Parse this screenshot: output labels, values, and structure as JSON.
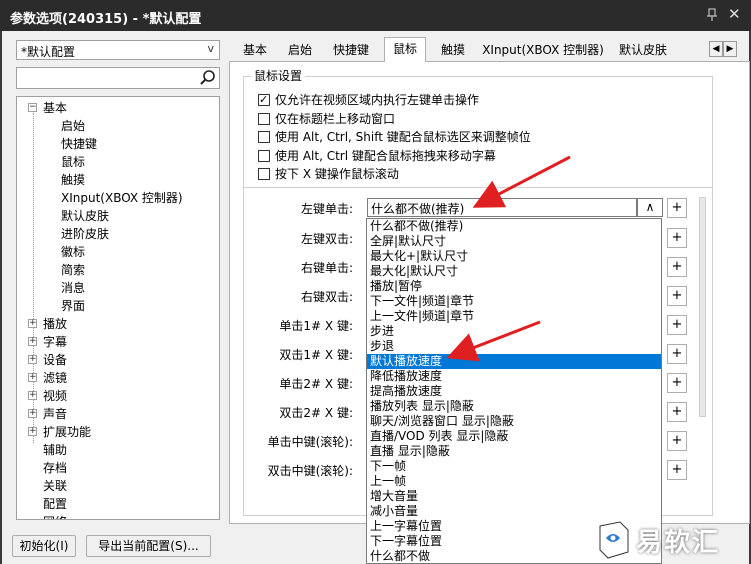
{
  "window": {
    "title": "参数选项(240315) - *默认配置",
    "pin_icon": "pin-icon",
    "close_icon": "close-icon"
  },
  "profile_select": {
    "value": "*默认配置"
  },
  "search": {
    "value": "",
    "icon": "search-icon"
  },
  "tree": {
    "items": [
      {
        "label": "基本",
        "level": 0,
        "expander": "minus"
      },
      {
        "label": "启始",
        "level": 1
      },
      {
        "label": "快捷键",
        "level": 1
      },
      {
        "label": "鼠标",
        "level": 1
      },
      {
        "label": "触摸",
        "level": 1
      },
      {
        "label": "XInput(XBOX 控制器)",
        "level": 1
      },
      {
        "label": "默认皮肤",
        "level": 1
      },
      {
        "label": "进阶皮肤",
        "level": 1
      },
      {
        "label": "徽标",
        "level": 1
      },
      {
        "label": "简索",
        "level": 1
      },
      {
        "label": "消息",
        "level": 1
      },
      {
        "label": "界面",
        "level": 1
      },
      {
        "label": "播放",
        "level": 0,
        "expander": "plus"
      },
      {
        "label": "字幕",
        "level": 0,
        "expander": "plus"
      },
      {
        "label": "设备",
        "level": 0,
        "expander": "plus"
      },
      {
        "label": "滤镜",
        "level": 0,
        "expander": "plus"
      },
      {
        "label": "视频",
        "level": 0,
        "expander": "plus"
      },
      {
        "label": "声音",
        "level": 0,
        "expander": "plus"
      },
      {
        "label": "扩展功能",
        "level": 0,
        "expander": "plus"
      },
      {
        "label": "辅助",
        "level": 0
      },
      {
        "label": "存档",
        "level": 0
      },
      {
        "label": "关联",
        "level": 0
      },
      {
        "label": "配置",
        "level": 0
      },
      {
        "label": "网络",
        "level": 0
      }
    ]
  },
  "buttons": {
    "init": "初始化(I)",
    "export": "导出当前配置(S)..."
  },
  "tabs": [
    "基本",
    "启始",
    "快捷键",
    "鼠标",
    "触摸",
    "XInput(XBOX 控制器)",
    "默认皮肤"
  ],
  "active_tab": "鼠标",
  "group_title": "鼠标设置",
  "checkboxes": [
    {
      "label": "仅允许在视频区域内执行左键单击操作",
      "checked": true
    },
    {
      "label": "仅在标题栏上移动窗口",
      "checked": false
    },
    {
      "label": "使用 Alt, Ctrl, Shift 键配合鼠标选区来调整帧位",
      "checked": false
    },
    {
      "label": "使用 Alt, Ctrl 键配合鼠标拖拽来移动字幕",
      "checked": false
    },
    {
      "label": "按下 X 键操作鼠标滚动",
      "checked": false
    }
  ],
  "actions": [
    {
      "label": "左键单击:",
      "value": "什么都不做(推荐)"
    },
    {
      "label": "左键双击:"
    },
    {
      "label": "右键单击:"
    },
    {
      "label": "右键双击:"
    },
    {
      "label": "单击1# X 键:"
    },
    {
      "label": "双击1# X 键:"
    },
    {
      "label": "单击2# X 键:"
    },
    {
      "label": "双击2# X 键:"
    },
    {
      "label": "单击中键(滚轮):"
    },
    {
      "label": "双击中键(滚轮):"
    }
  ],
  "dropdown_button": "∧",
  "plus_label": "+",
  "dropdown_items": [
    "什么都不做(推荐)",
    "全屏|默认尺寸",
    "最大化+|默认尺寸",
    "最大化|默认尺寸",
    "播放|暂停",
    "下一文件|频道|章节",
    "上一文件|频道|章节",
    "步进",
    "步退",
    "默认播放速度",
    "降低播放速度",
    "提高播放速度",
    "播放列表 显示|隐蔽",
    "聊天/浏览器窗口 显示|隐蔽",
    "直播/VOD 列表 显示|隐蔽",
    "直播 显示|隐蔽",
    "下一帧",
    "上一帧",
    "增大音量",
    "减小音量",
    "上一字幕位置",
    "下一字幕位置",
    "什么都不做"
  ],
  "dropdown_selected": "默认播放速度",
  "colors": {
    "titlebar": "#2b2b2b",
    "selection": "#0078d7",
    "annotation_arrow": "#e02020"
  },
  "watermark": {
    "text": "易软汇",
    "icon": "logo-icon"
  }
}
